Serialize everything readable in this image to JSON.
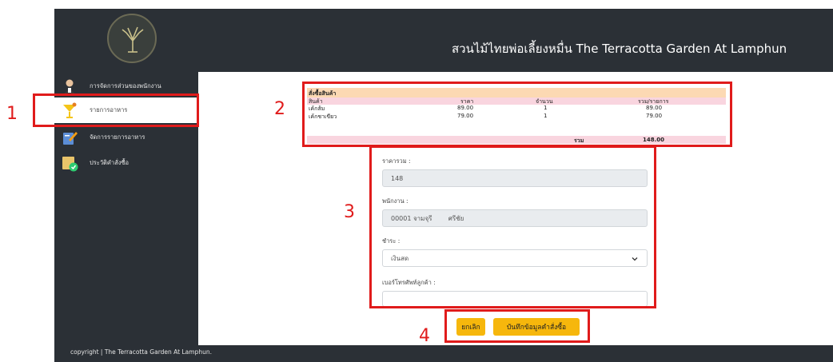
{
  "header": {
    "title": "สวนไม้ไทยพ่อเลี้ยงหมื่น The Terracotta Garden At Lamphun"
  },
  "sidebar": {
    "items": [
      {
        "label": "การจัดการส่วนของพนักงาน",
        "icon": "staff-icon"
      },
      {
        "label": "รายการอาหาร",
        "icon": "cocktail-icon"
      },
      {
        "label": "จัดการรายการอาหาร",
        "icon": "edit-menu-icon"
      },
      {
        "label": "ประวัติคำสั่งซื้อ",
        "icon": "order-history-icon"
      }
    ]
  },
  "annotations": [
    "1",
    "2",
    "3",
    "4"
  ],
  "order": {
    "title": "สั่งซื้อสินค้า",
    "headers": [
      "สินค้า",
      "ราคา",
      "จำนวน",
      "รวม/รายการ"
    ],
    "rows": [
      {
        "name": "เค้กส้ม",
        "price": "89.00",
        "qty": "1",
        "subtotal": "89.00"
      },
      {
        "name": "เค้กชาเขียว",
        "price": "79.00",
        "qty": "1",
        "subtotal": "79.00"
      }
    ],
    "total_label": "รวม",
    "total_value": "148.00"
  },
  "form": {
    "price_label": "ราคารวม :",
    "price_value": "148",
    "staff_label": "พนักงาน :",
    "staff_value": "00001 จามจุรี        ศรีชัย",
    "pay_label": "ชำระ :",
    "pay_value": "เงินสด",
    "phone_label": "เบอร์โทรศัพท์ลูกค้า :",
    "phone_value": ""
  },
  "buttons": {
    "cancel": "ยกเลิก",
    "save": "บันทึกข้อมูลคำสั่งซื้อ"
  },
  "footer": {
    "text": "copyright | The Terracotta Garden At Lamphun."
  },
  "colors": {
    "dark": "#2b3036",
    "accent": "#f6b70c",
    "annotation": "#e01b1b",
    "order_title_bg": "#fcd9b3",
    "order_head_bg": "#f9d5df"
  }
}
